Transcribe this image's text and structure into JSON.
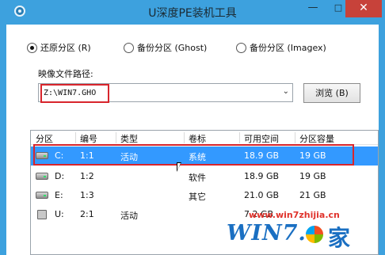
{
  "window": {
    "title": "U深度PE装机工具",
    "minimize": "—",
    "maximize": "□",
    "close": "✕"
  },
  "mode": {
    "options": [
      {
        "label": "还原分区 (R)",
        "selected": true
      },
      {
        "label": "备份分区 (Ghost)",
        "selected": false
      },
      {
        "label": "备份分区 (Imagex)",
        "selected": false
      }
    ]
  },
  "image_path": {
    "label": "映像文件路径:",
    "value": "Z:\\WIN7.GHO",
    "browse_label": "浏览 (B)"
  },
  "partitions": {
    "columns": [
      "分区",
      "编号",
      "类型",
      "卷标",
      "可用空间",
      "分区容量"
    ],
    "rows": [
      {
        "drive": "C:",
        "number": "1:1",
        "type": "活动",
        "label": "系统",
        "free": "18.9 GB",
        "size": "19 GB",
        "selected": true,
        "icon": "hard-drive-icon"
      },
      {
        "drive": "D:",
        "number": "1:2",
        "type": "",
        "label": "软件",
        "free": "18.9 GB",
        "size": "19 GB",
        "selected": false,
        "icon": "hard-drive-icon"
      },
      {
        "drive": "E:",
        "number": "1:3",
        "type": "",
        "label": "其它",
        "free": "21.0 GB",
        "size": "21 GB",
        "selected": false,
        "icon": "hard-drive-icon"
      },
      {
        "drive": "U:",
        "number": "2:1",
        "type": "活动",
        "label": "",
        "free": "7.2 GB",
        "size": "",
        "selected": false,
        "icon": "usb-drive-icon"
      }
    ]
  },
  "watermark": {
    "url": "www.win7zhijia.cn",
    "logo": "WIN7.",
    "suffix": "家"
  },
  "colors": {
    "titlebar": "#3da1de",
    "selection": "#3399ff",
    "highlight": "#d8252c",
    "close": "#c7423a"
  }
}
